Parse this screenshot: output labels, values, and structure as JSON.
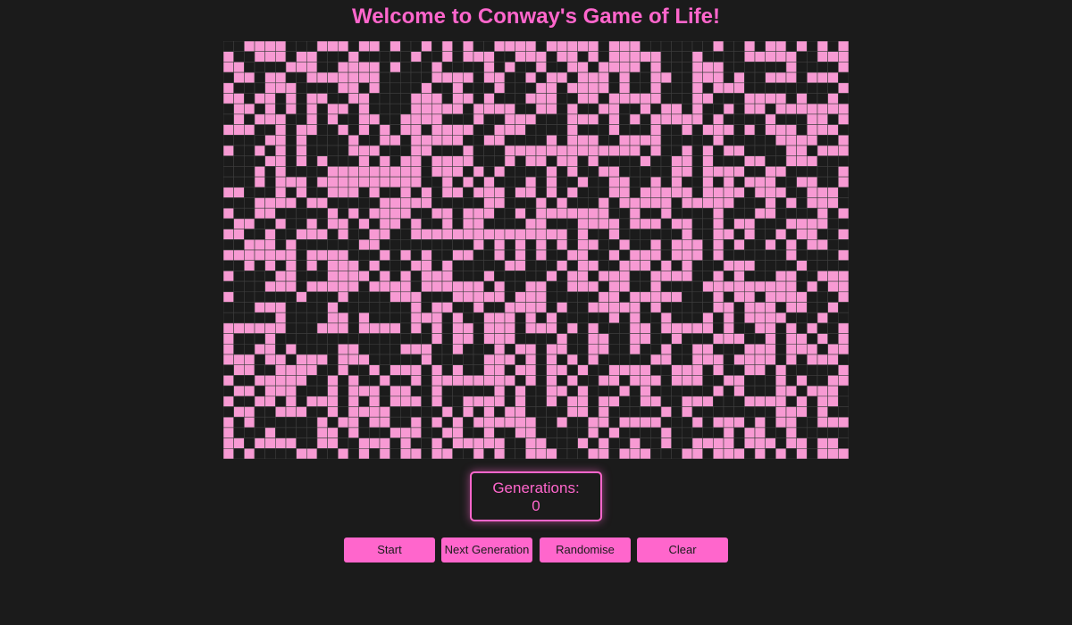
{
  "page": {
    "title": "Welcome to Conway's Game of Life!"
  },
  "grid": {
    "rows": 40,
    "cols": 60,
    "alive_color": "#f79ad3",
    "dead_color": "#1b1b1b",
    "line_color": "#3f3f3f",
    "seed": 1337,
    "alive_ratio": 0.5
  },
  "generations": {
    "label": "Generations:",
    "count": "0"
  },
  "controls": {
    "start_label": "Start",
    "next_label": "Next Generation",
    "randomise_label": "Randomise",
    "clear_label": "Clear"
  },
  "theme": {
    "accent": "#ff66cc",
    "background": "#1b1b1b"
  }
}
